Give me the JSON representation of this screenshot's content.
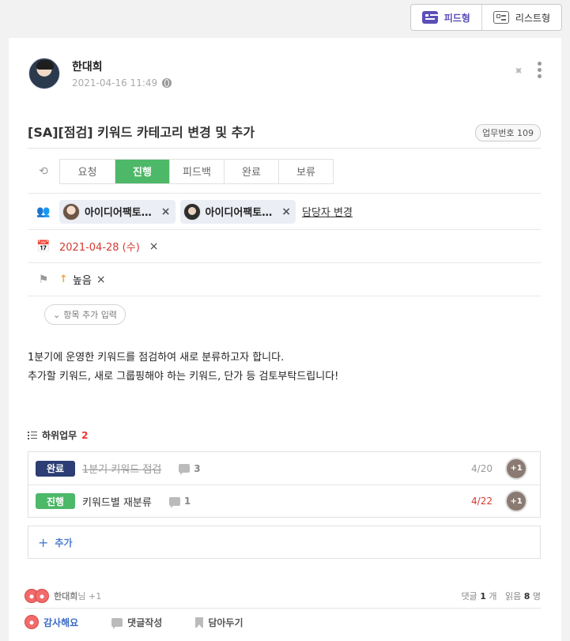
{
  "view_toggle": {
    "feed_label": "피드형",
    "list_label": "리스트형"
  },
  "author": {
    "name": "한대희",
    "timestamp": "2021-04-16 11:49"
  },
  "post": {
    "title": "[SA][점검] 키워드 카테고리 변경 및 추가",
    "task_number": "업무번호 109",
    "body_lines": [
      "1분기에 운영한 키워드를 점검하여 새로 분류하고자 합니다.",
      "추가할 키워드, 새로 그룹핑해야 하는 키워드, 단가 등 검토부탁드립니다!"
    ]
  },
  "status": {
    "tabs": [
      "요청",
      "진행",
      "피드백",
      "완료",
      "보류"
    ],
    "active": "진행",
    "active_color": "#4db868"
  },
  "assignees": {
    "chips": [
      "아이디어팩토…",
      "아이디어팩토…"
    ],
    "remove_symbol": "×",
    "change_label": "담당자 변경"
  },
  "due_date": {
    "value": "2021-04-28 (수)",
    "color": "#d33b32",
    "remove_symbol": "×"
  },
  "priority": {
    "arrow": "↑",
    "label": "높음",
    "remove_symbol": "×"
  },
  "add_field_label": "항목 추가 입력",
  "subtasks": {
    "heading": "하위업무",
    "count": "2",
    "items": [
      {
        "status": "완료",
        "title": "1분기 키워드 점검",
        "comments": "3",
        "due": "4/20",
        "assignee_label": "+1"
      },
      {
        "status": "진행",
        "title": "키워드별 재분류",
        "comments": "1",
        "due": "4/22",
        "assignee_label": "+1"
      }
    ],
    "add_label": "추가",
    "add_symbol": "+"
  },
  "reactions": {
    "reactor_name": "한대희",
    "reactor_suffix": "님 +1",
    "comment_label": "댓글",
    "comment_count": "1",
    "comment_unit": "개",
    "read_label": "읽음",
    "read_count": "8",
    "read_unit": "명"
  },
  "actions": {
    "thanks": "감사해요",
    "comment": "댓글작성",
    "bookmark": "담아두기"
  },
  "icons": {
    "pin": "📌",
    "chevron": "⌄"
  }
}
